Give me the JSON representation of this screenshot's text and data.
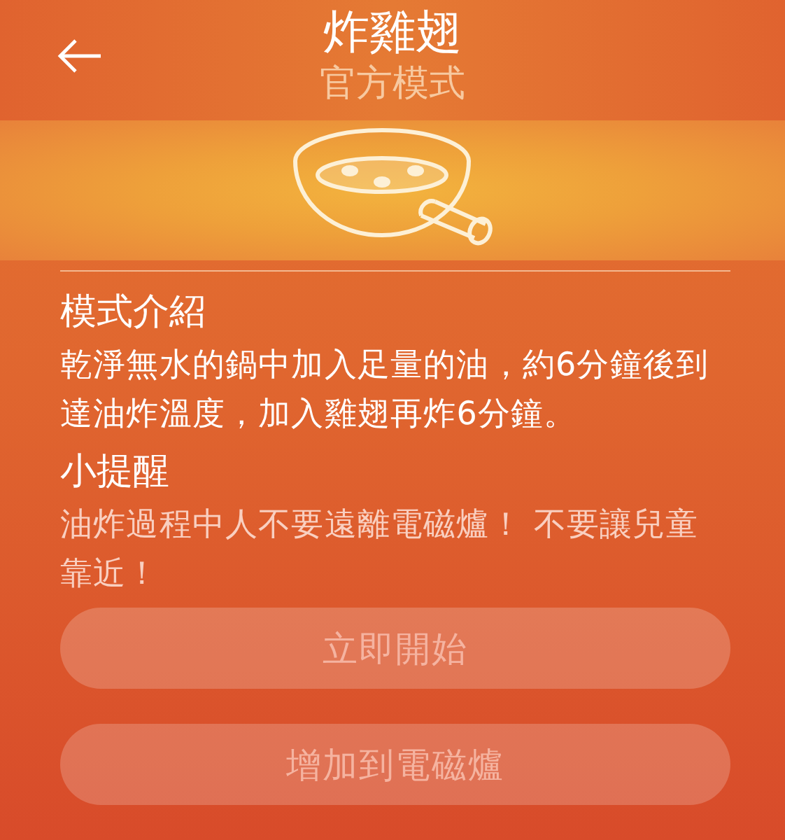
{
  "header": {
    "title": "炸雞翅",
    "subtitle": "官方模式"
  },
  "sections": [
    {
      "heading": "模式介紹",
      "text": "乾淨無水的鍋中加入足量的油，約6分鐘後到達油炸溫度，加入雞翅再炸6分鐘。",
      "kind": "intro"
    },
    {
      "heading": "小提醒",
      "text": "油炸過程中人不要遠離電磁爐！ 不要讓兒童靠近！",
      "kind": "tip"
    }
  ],
  "buttons": [
    "立即開始",
    "增加到電磁爐"
  ]
}
